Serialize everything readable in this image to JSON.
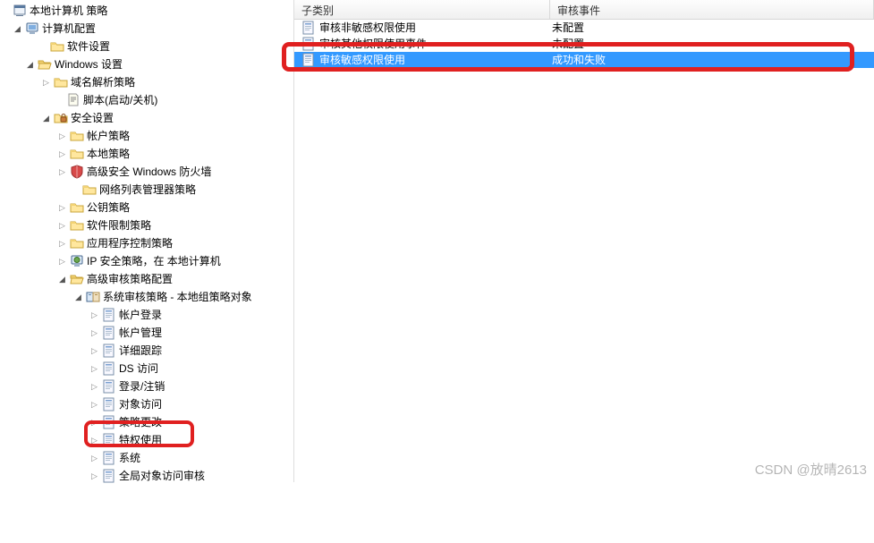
{
  "tree": {
    "root": "本地计算机 策略",
    "computer_config": "计算机配置",
    "software": "软件设置",
    "windows": "Windows 设置",
    "domain_resolve": "域名解析策略",
    "scripts": "脚本(启动/关机)",
    "security": "安全设置",
    "account_policy": "帐户策略",
    "local_policy": "本地策略",
    "firewall": "高级安全 Windows 防火墙",
    "netlist": "网络列表管理器策略",
    "pubkey": "公钥策略",
    "software_restrict": "软件限制策略",
    "app_control": "应用程序控制策略",
    "ip_sec": "IP 安全策略，在 本地计算机",
    "advanced_audit": "高级审核策略配置",
    "sys_audit": "系统审核策略 - 本地组策略对象",
    "account_logon": "帐户登录",
    "account_mgmt": "帐户管理",
    "detailed": "详细跟踪",
    "ds_access": "DS 访问",
    "logon_logoff": "登录/注销",
    "object_access": "对象访问",
    "policy_change": "策略更改",
    "privilege_use": "特权使用",
    "system": "系统",
    "global_object": "全局对象访问审核"
  },
  "list": {
    "header_sub": "子类别",
    "header_evt": "审核事件",
    "rows": [
      {
        "name": "审核非敏感权限使用",
        "event": "未配置"
      },
      {
        "name": "审核其他权限使用事件",
        "event": "未配置"
      },
      {
        "name": "审核敏感权限使用",
        "event": "成功和失败"
      }
    ]
  },
  "watermark": "CSDN @放晴2613"
}
